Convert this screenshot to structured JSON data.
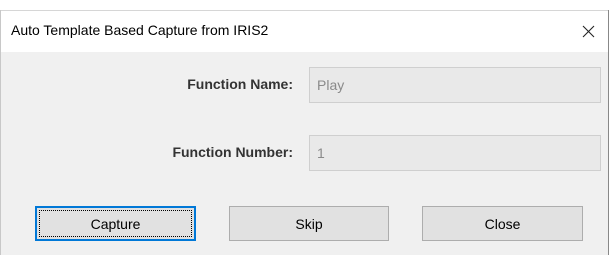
{
  "window": {
    "title": "Auto Template Based Capture from IRIS2"
  },
  "fields": {
    "function_name_label": "Function Name:",
    "function_name_value": "Play",
    "function_number_label": "Function Number:",
    "function_number_value": "1"
  },
  "buttons": {
    "capture_label": "Capture",
    "skip_label": "Skip",
    "close_label": "Close"
  },
  "icons": {
    "close": "close-icon"
  },
  "colors": {
    "default_button_border": "#0078d7",
    "field_background": "#e9e9e9",
    "dialog_background": "#f0f0f0"
  }
}
